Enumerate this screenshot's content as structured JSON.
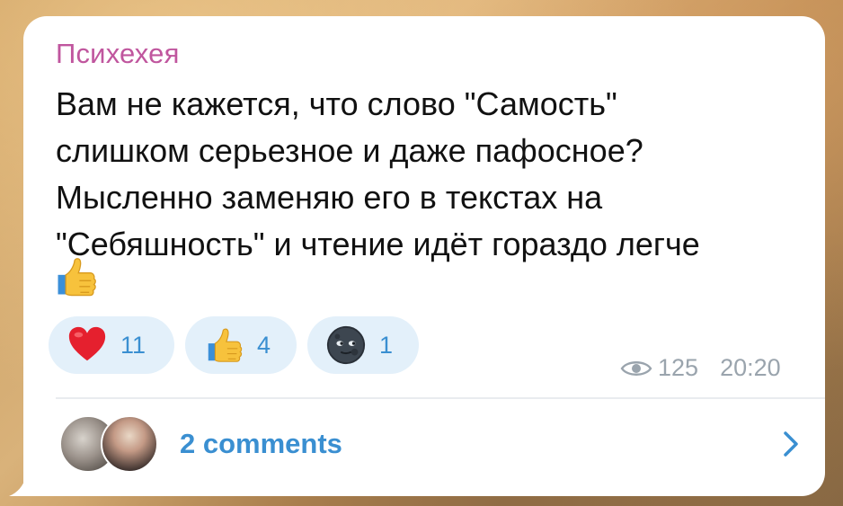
{
  "post": {
    "sender": "Психехея",
    "text_lines": [
      "Вам не кажется, что слово \"Самость\"",
      "слишком серьезное и даже пафосное?",
      "Мысленно заменяю его в текстах на",
      "\"Себяшность\" и чтение идёт гораздо легче"
    ],
    "trailing_emoji": "thumbs-up-emoji"
  },
  "reactions": [
    {
      "emoji": "red-heart-emoji",
      "count": "11"
    },
    {
      "emoji": "thumbs-up-emoji",
      "count": "4"
    },
    {
      "emoji": "new-moon-face-emoji",
      "count": "1"
    }
  ],
  "meta": {
    "views": "125",
    "time": "20:20",
    "views_icon": "eye-icon"
  },
  "comments": {
    "label": "2 comments",
    "chevron_icon": "chevron-right-icon"
  },
  "colors": {
    "sender": "#c0569e",
    "accent": "#3a8fd1",
    "reaction_bg": "#e3f0fa",
    "meta": "#9aa4ad"
  }
}
